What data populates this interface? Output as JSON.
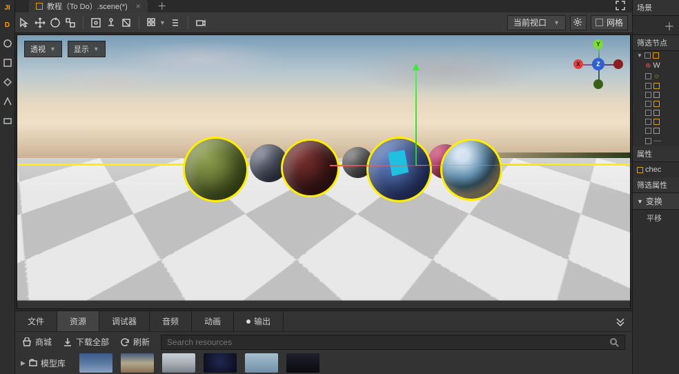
{
  "tabs": {
    "scene_title": "教程（To Do）.scene(*)"
  },
  "toolbar": {
    "viewport_mode": "当前视口",
    "grid_label": "网格"
  },
  "viewport": {
    "view_mode": "透视",
    "display_mode": "显示",
    "gizmo": {
      "x": "X",
      "y": "Y",
      "z": "Z"
    }
  },
  "bottom_tabs": {
    "file": "文件",
    "resources": "资源",
    "debugger": "调试器",
    "audio": "音频",
    "animation": "动画",
    "output": "输出"
  },
  "resource_bar": {
    "store": "商城",
    "download_all": "下载全部",
    "refresh": "刷新",
    "search_placeholder": "Search resources"
  },
  "assets": {
    "root_folder": "模型库"
  },
  "right": {
    "scene_header": "场景",
    "filter_nodes": "筛选节点",
    "tree": {
      "world": "W",
      "checker": "chec"
    },
    "properties_header": "属性",
    "filter_properties": "筛选属性",
    "transform_section": "变换",
    "translate": "平移"
  }
}
